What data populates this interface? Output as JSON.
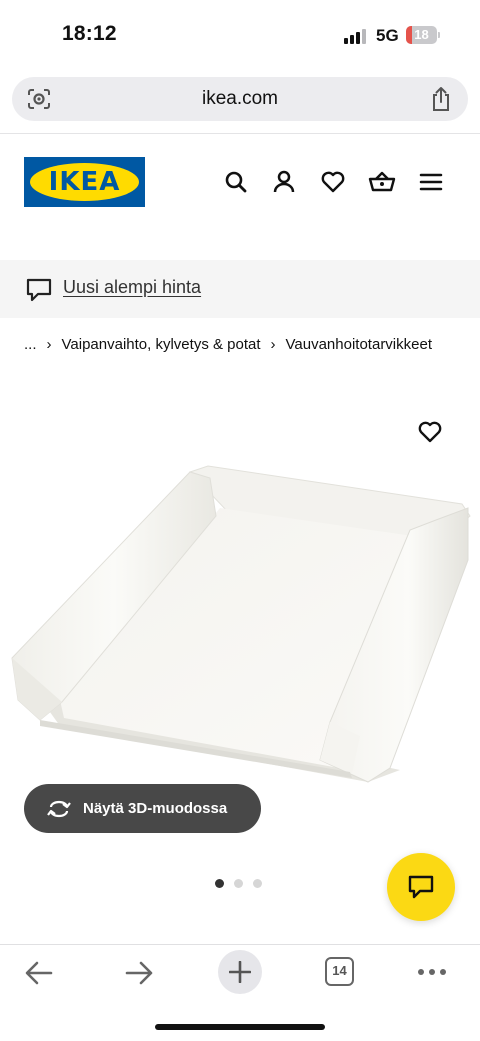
{
  "status_bar": {
    "time": "18:12",
    "network": "5G",
    "battery_level": "18",
    "battery_fraction": 0.18,
    "battery_color": "#e5534b"
  },
  "browser": {
    "url": "ikea.com",
    "left_icon": "screen-lens-icon",
    "right_icon": "share-icon",
    "tab_count": "14"
  },
  "header": {
    "logo_text": "IKEA",
    "brand_blue": "#0058a3",
    "brand_yellow": "#ffdb00",
    "icons": [
      "search-icon",
      "account-icon",
      "heart-icon",
      "basket-icon",
      "menu-icon"
    ]
  },
  "promo": {
    "icon": "speech-bubble-icon",
    "label": "Uusi alempi hinta"
  },
  "breadcrumb": {
    "items": [
      "...",
      "Vaipanvaihto, kylvetys & potat",
      "Vauvanhoitotarvikkeet"
    ],
    "separator": "›"
  },
  "product": {
    "view_3d_label": "Näytä 3D-muodossa",
    "image_count": 3,
    "active_image": 1
  },
  "chat": {
    "icon": "chat-icon",
    "color": "#fbd914"
  },
  "toolbar": {
    "icons": [
      "back-icon",
      "forward-icon",
      "new-tab-icon",
      "tabs-icon",
      "more-icon"
    ]
  }
}
